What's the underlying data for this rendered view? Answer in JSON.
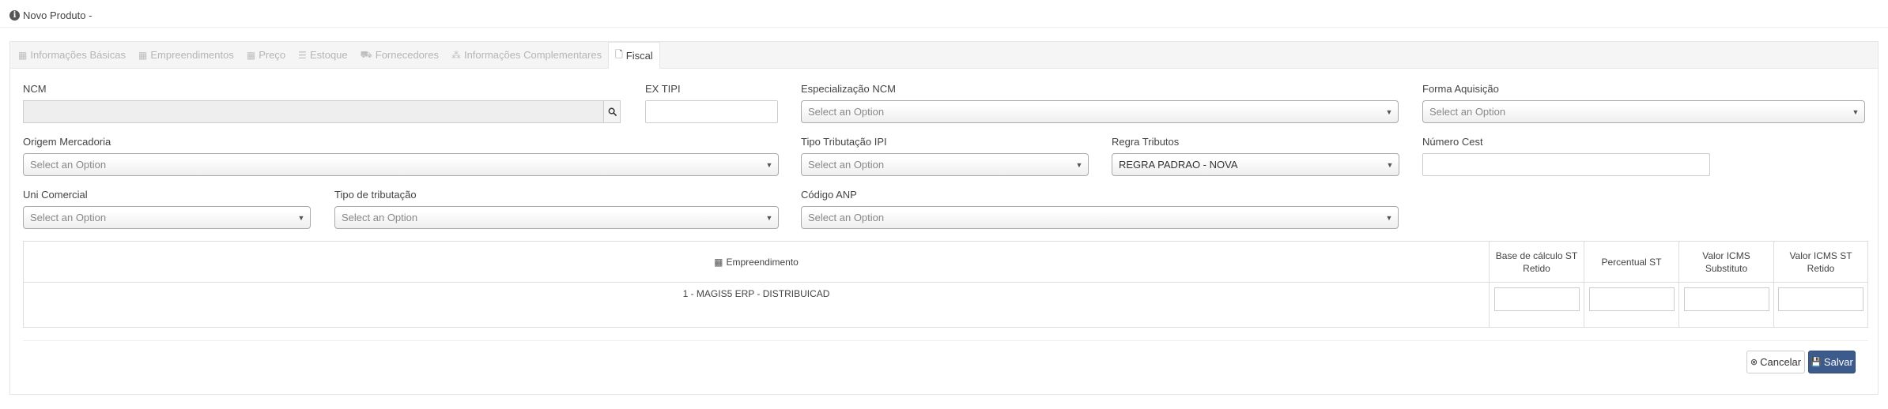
{
  "header": {
    "title": "Novo Produto -"
  },
  "tabs": [
    {
      "label": "Informações Básicas",
      "icon": "building-icon"
    },
    {
      "label": "Empreendimentos",
      "icon": "building-icon"
    },
    {
      "label": "Preço",
      "icon": "building-icon"
    },
    {
      "label": "Estoque",
      "icon": "list-icon"
    },
    {
      "label": "Fornecedores",
      "icon": "truck-icon"
    },
    {
      "label": "Informações Complementares",
      "icon": "cubes-icon"
    },
    {
      "label": "Fiscal",
      "icon": "file-icon"
    }
  ],
  "fields": {
    "ncm": {
      "label": "NCM",
      "value": ""
    },
    "ex_tipi": {
      "label": "EX TIPI",
      "value": ""
    },
    "especializacao_ncm": {
      "label": "Especialização NCM",
      "value": "Select an Option"
    },
    "forma_aquisicao": {
      "label": "Forma Aquisição",
      "value": "Select an Option"
    },
    "origem_mercadoria": {
      "label": "Origem Mercadoria",
      "value": "Select an Option"
    },
    "tipo_tributacao_ipi": {
      "label": "Tipo Tributação IPI",
      "value": "Select an Option"
    },
    "regra_tributos": {
      "label": "Regra Tributos",
      "value": "REGRA PADRAO - NOVA"
    },
    "numero_cest": {
      "label": "Número Cest",
      "value": ""
    },
    "uni_comercial": {
      "label": "Uni Comercial",
      "value": "Select an Option"
    },
    "tipo_tributacao": {
      "label": "Tipo de tributação",
      "value": "Select an Option"
    },
    "codigo_anp": {
      "label": "Código ANP",
      "value": "Select an Option"
    }
  },
  "grid": {
    "headers": {
      "empreendimento": "Empreendimento",
      "base_calculo": "Base de cálculo ST Retido",
      "percentual": "Percentual ST",
      "valor_substituto": "Valor ICMS Substituto",
      "valor_retido": "Valor ICMS ST Retido"
    },
    "rows": [
      {
        "empreendimento": "1 - MAGIS5 ERP - DISTRIBUICAD"
      }
    ]
  },
  "buttons": {
    "cancel": "Cancelar",
    "save": "Salvar"
  },
  "colors": {
    "save_button": "#3c5a8c",
    "tab_inactive_text": "#b5b5b5"
  }
}
